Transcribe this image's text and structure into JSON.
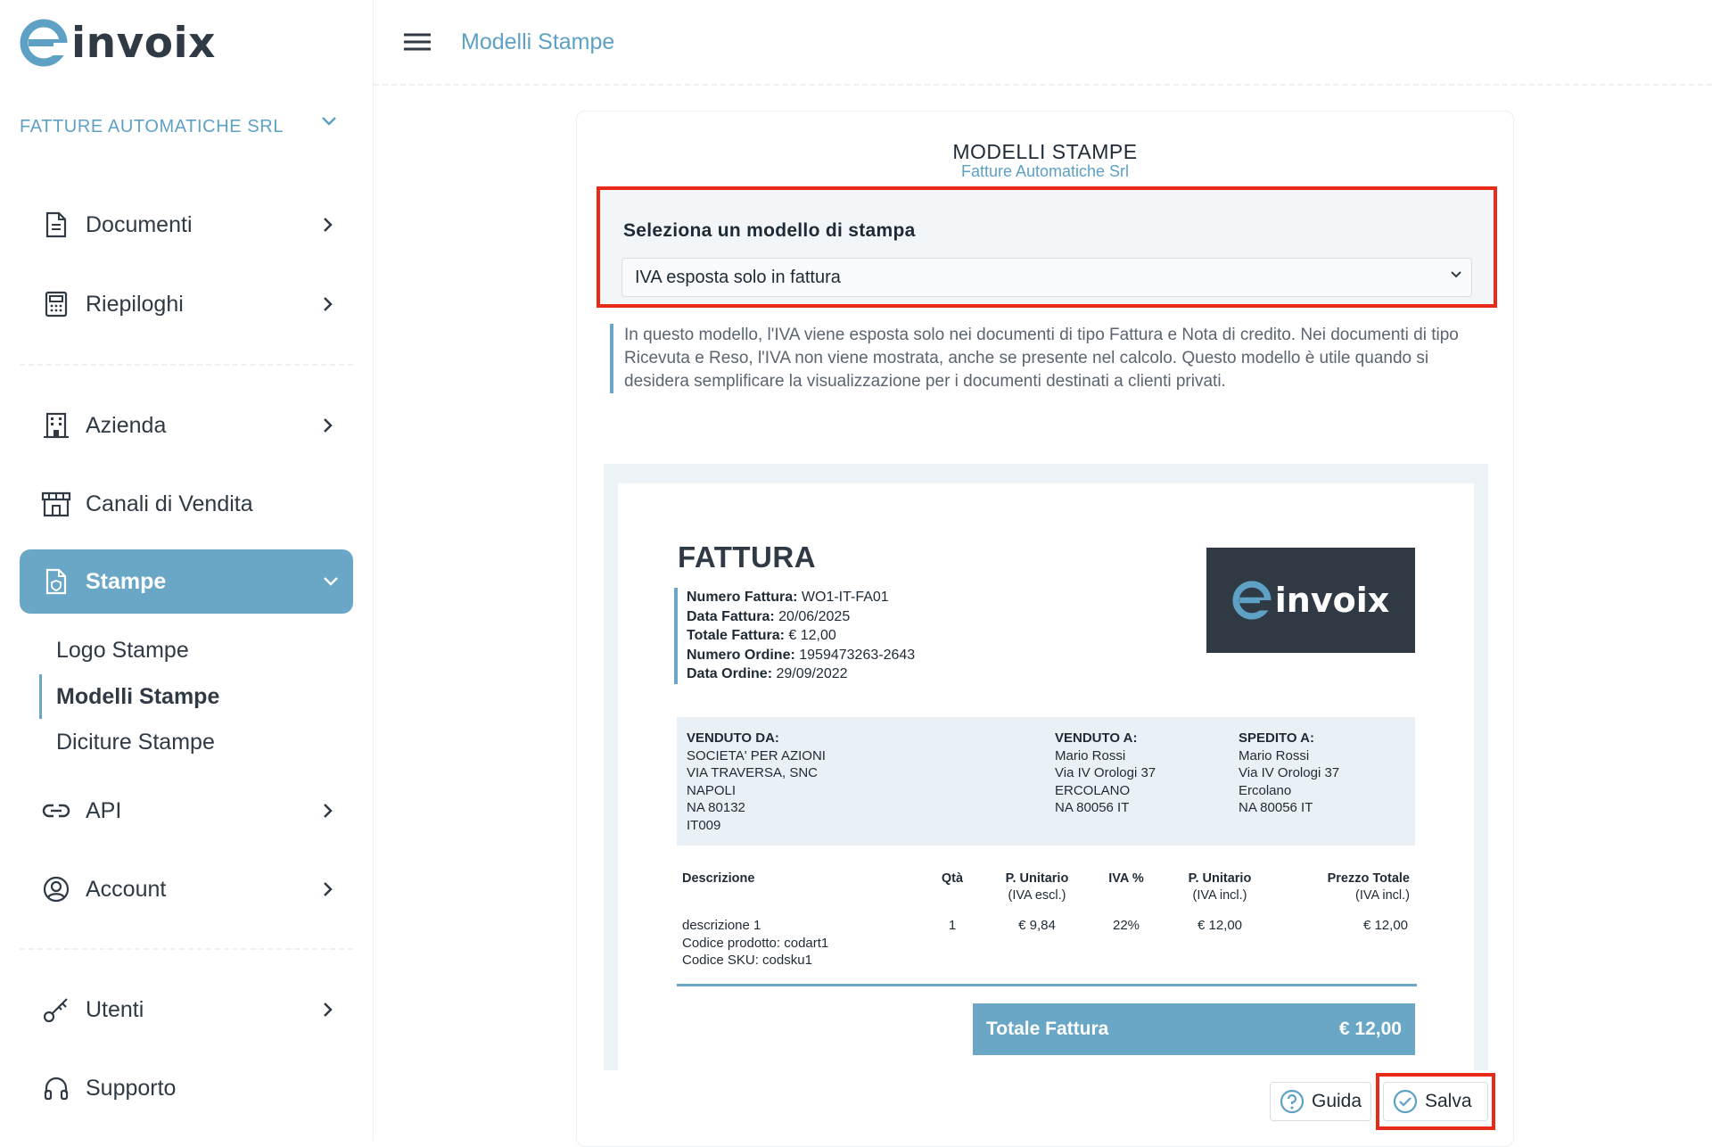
{
  "app": {
    "logo_text": "invoix",
    "brand_color": "#5ea1c4",
    "highlight_color": "#ea2a18"
  },
  "sidebar": {
    "company": "FATTURE AUTOMATICHE SRL",
    "items": [
      {
        "label": "Documenti",
        "icon": "document-icon"
      },
      {
        "label": "Riepiloghi",
        "icon": "calculator-icon"
      },
      {
        "label": "Azienda",
        "icon": "building-icon"
      },
      {
        "label": "Canali di Vendita",
        "icon": "store-icon"
      },
      {
        "label": "Stampe",
        "icon": "print-document-icon"
      },
      {
        "label": "API",
        "icon": "link-icon"
      },
      {
        "label": "Account",
        "icon": "user-circle-icon"
      },
      {
        "label": "Utenti",
        "icon": "key-icon"
      },
      {
        "label": "Supporto",
        "icon": "headset-icon"
      }
    ],
    "stampe_sub": [
      "Logo Stampe",
      "Modelli Stampe",
      "Diciture Stampe"
    ]
  },
  "header": {
    "title": "Modelli Stampe"
  },
  "card": {
    "title": "MODELLI STAMPE",
    "subtitle": "Fatture Automatiche Srl",
    "select_label": "Seleziona un modello di stampa",
    "select_value": "IVA esposta solo in fattura",
    "description": "In questo modello, l'IVA viene esposta solo nei documenti di tipo Fattura e Nota di credito. Nei documenti di tipo Ricevuta e Reso, l'IVA non viene mostrata, anche se presente nel calcolo. Questo modello è utile quando si desidera semplificare la visualizzazione per i documenti destinati a clienti privati."
  },
  "invoice": {
    "title": "FATTURA",
    "logo_text": "invoix",
    "meta": [
      {
        "k": "Numero Fattura:",
        "v": "WO1-IT-FA01"
      },
      {
        "k": "Data Fattura:",
        "v": "20/06/2025"
      },
      {
        "k": "Totale Fattura:",
        "v": "€ 12,00"
      },
      {
        "k": "Numero Ordine:",
        "v": "1959473263-2643"
      },
      {
        "k": "Data Ordine:",
        "v": "29/09/2022"
      }
    ],
    "venduto_da": {
      "h": "VENDUTO DA:",
      "lines": [
        "SOCIETA' PER AZIONI",
        "VIA TRAVERSA, SNC",
        "NAPOLI",
        "NA 80132",
        "IT009"
      ]
    },
    "venduto_a": {
      "h": "VENDUTO A:",
      "lines": [
        "Mario Rossi",
        "Via IV Orologi 37",
        "ERCOLANO",
        "NA 80056 IT"
      ]
    },
    "spedito_a": {
      "h": "SPEDITO A:",
      "lines": [
        "Mario Rossi",
        "Via IV Orologi 37",
        "Ercolano",
        "NA 80056 IT"
      ]
    },
    "columns": {
      "descr": "Descrizione",
      "qty": "Qtà",
      "pu_ex": "P. Unitario",
      "pu_ex_s": "(IVA escl.)",
      "iva": "IVA %",
      "pu_in": "P. Unitario",
      "pu_in_s": "(IVA incl.)",
      "tot": "Prezzo Totale",
      "tot_s": "(IVA incl.)"
    },
    "row": {
      "descr": [
        "descrizione 1",
        "Codice prodotto: codart1",
        "Codice SKU: codsku1"
      ],
      "qty": "1",
      "pu_ex": "€ 9,84",
      "iva": "22%",
      "pu_in": "€ 12,00",
      "tot": "€ 12,00"
    },
    "total_label": "Totale Fattura",
    "total_value": "€ 12,00"
  },
  "buttons": {
    "guida": "Guida",
    "salva": "Salva"
  }
}
